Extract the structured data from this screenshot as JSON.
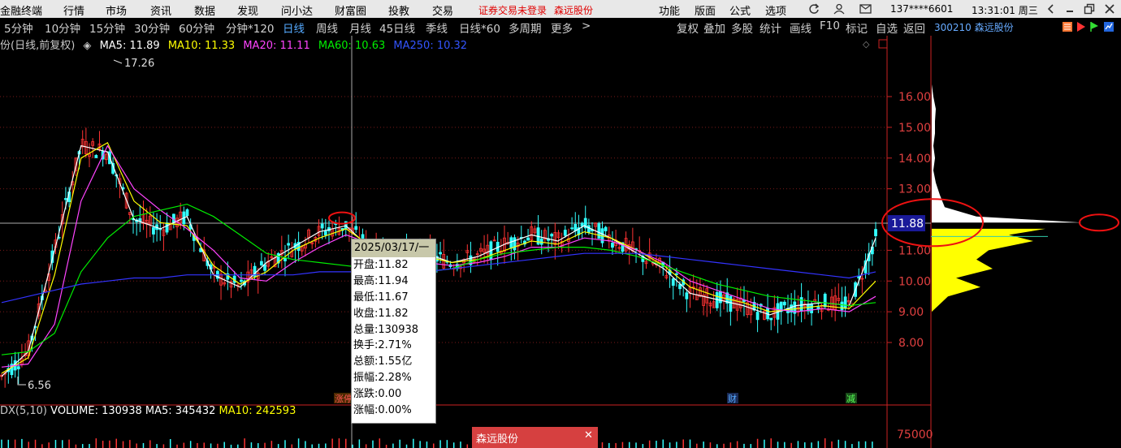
{
  "menubar": {
    "app_name": "金融终端",
    "items": [
      "行情",
      "市场",
      "资讯",
      "数据",
      "发现",
      "问小达",
      "财富圈",
      "投教",
      "交易"
    ],
    "notice": "证券交易未登录",
    "stock_name": "森远股份",
    "right_items": [
      "功能",
      "版面",
      "公式",
      "选项"
    ],
    "account": "137****6601",
    "clock": "13:31:01 周三"
  },
  "periods": {
    "items": [
      "5分钟",
      "10分钟",
      "15分钟",
      "30分钟",
      "60分钟",
      "分钟*120",
      "日线",
      "周线",
      "月线",
      "45日线",
      "季线",
      "日线*60",
      "多周期",
      "更多"
    ],
    "active": "日线",
    "more_arrow": ">"
  },
  "tools": [
    "复权",
    "叠加",
    "多股",
    "统计",
    "画线",
    "F10",
    "标记",
    "自选",
    "返回"
  ],
  "right_panel": {
    "code": "300210",
    "name": "森远股份"
  },
  "ma_legend": {
    "title": "份(日线,前复权)",
    "ma5": "MA5: 11.89",
    "ma10": "MA10: 11.33",
    "ma20": "MA20: 11.11",
    "ma60": "MA60: 10.63",
    "ma250": "MA250: 10.32",
    "colors": {
      "ma5": "#ffffff",
      "ma10": "#ffff00",
      "ma20": "#ff44ff",
      "ma60": "#00ee00",
      "ma250": "#3333ff"
    }
  },
  "price_axis": {
    "ticks": [
      "16.00",
      "15.00",
      "14.00",
      "13.00",
      "11.00",
      "10.00",
      "9.00",
      "8.00"
    ],
    "current_price": "11.88",
    "vol_tick": "75000"
  },
  "annotations": {
    "high_label": "17.26",
    "low_label": "6.56",
    "marker_zhangting": "涨停",
    "marker_cai": "财",
    "marker_jian": "减"
  },
  "tooltip": {
    "date": "2025/03/17/一",
    "rows": [
      "开盘:11.82",
      "最高:11.94",
      "最低:11.67",
      "收盘:11.82",
      "总量:130938",
      "换手:2.71%",
      "总额:1.55亿",
      "振幅:2.28%",
      "涨跌:0.00",
      "涨幅:0.00%"
    ]
  },
  "volume_legend": {
    "name": "DX(5,10)",
    "volume": "VOLUME: 130938",
    "ma5": "MA5: 345432",
    "ma10": "MA10: 242593"
  },
  "popup": {
    "title": "森远股份",
    "close": "✕"
  },
  "chart_data": {
    "type": "line",
    "series": [
      {
        "name": "MA5",
        "values": [
          6.9,
          7.7,
          11.0,
          14.4,
          14.2,
          12.0,
          11.7,
          12.1,
          10.2,
          9.8,
          10.6,
          11.1,
          11.6,
          11.8,
          11.0,
          10.8,
          10.9,
          10.6,
          10.8,
          11.2,
          11.5,
          11.3,
          11.8,
          11.4,
          10.9,
          10.4,
          9.6,
          9.4,
          9.2,
          8.9,
          9.2,
          9.3,
          9.2,
          11.4
        ]
      },
      {
        "name": "MA10",
        "values": [
          7.0,
          7.5,
          10.2,
          14.0,
          14.5,
          12.6,
          11.9,
          11.8,
          10.5,
          9.9,
          10.3,
          11.0,
          11.4,
          11.7,
          11.1,
          10.8,
          10.8,
          10.6,
          10.7,
          11.0,
          11.3,
          11.2,
          11.6,
          11.4,
          11.0,
          10.5,
          9.8,
          9.5,
          9.3,
          9.0,
          9.1,
          9.2,
          9.1,
          10.0
        ]
      },
      {
        "name": "MA20",
        "values": [
          7.2,
          7.3,
          8.6,
          12.6,
          14.4,
          13.0,
          12.3,
          11.7,
          11.0,
          10.1,
          10.0,
          10.6,
          11.1,
          11.5,
          11.2,
          10.9,
          10.6,
          10.5,
          10.6,
          10.8,
          11.1,
          11.1,
          11.4,
          11.3,
          11.0,
          10.6,
          10.0,
          9.7,
          9.4,
          9.1,
          9.0,
          9.1,
          9.0,
          9.5
        ]
      },
      {
        "name": "MA60",
        "values": [
          7.6,
          7.7,
          8.3,
          10.3,
          11.4,
          12.1,
          12.3,
          12.5,
          12.1,
          11.5,
          10.9,
          10.7,
          10.6,
          10.5,
          10.4,
          10.3,
          10.3,
          10.4,
          10.7,
          10.9,
          11.0,
          11.1,
          11.1,
          11.0,
          10.8,
          10.5,
          10.2,
          9.9,
          9.7,
          9.5,
          9.4,
          9.3,
          9.2,
          9.3
        ]
      },
      {
        "name": "MA250",
        "values": [
          9.3,
          9.5,
          9.7,
          9.9,
          10.0,
          10.1,
          10.1,
          10.2,
          10.2,
          10.2,
          10.2,
          10.2,
          10.3,
          10.3,
          10.3,
          10.3,
          10.3,
          10.4,
          10.5,
          10.6,
          10.7,
          10.8,
          10.9,
          10.9,
          10.9,
          10.8,
          10.7,
          10.6,
          10.5,
          10.4,
          10.3,
          10.2,
          10.1,
          10.3
        ]
      }
    ],
    "ylim": [
      7.3,
      18.0
    ],
    "volume_profile": {
      "prices": [
        16.4,
        16.0,
        15.6,
        15.2,
        14.8,
        14.4,
        14.0,
        13.6,
        13.2,
        12.8,
        12.4,
        12.1,
        11.9,
        11.7,
        11.5,
        11.3,
        11.0,
        10.7,
        10.4,
        10.1,
        9.8,
        9.5,
        9.2,
        9.0
      ],
      "values": [
        0,
        2,
        5,
        4,
        4,
        2,
        4,
        2,
        5,
        10,
        16,
        55,
        185,
        140,
        95,
        125,
        70,
        55,
        75,
        30,
        60,
        20,
        8,
        0
      ]
    }
  }
}
